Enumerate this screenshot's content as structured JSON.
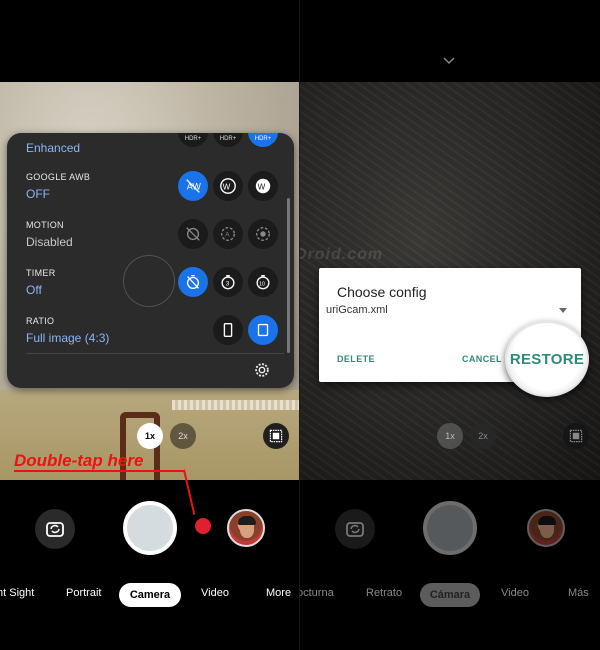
{
  "left_screen": {
    "settings": {
      "hdr_value": "Enhanced",
      "google_awb": {
        "label": "GOOGLE AWB",
        "value": "OFF"
      },
      "motion": {
        "label": "MOTION",
        "value": "Disabled"
      },
      "timer": {
        "label": "TIMER",
        "value": "Off"
      },
      "ratio": {
        "label": "RATIO",
        "value": "Full image (4:3)"
      },
      "hdr_icon_text": "HDR+",
      "timer_3": "3",
      "timer_10": "10"
    },
    "zoom": {
      "one": "1x",
      "two": "2x"
    },
    "annotation": "Double-tap here",
    "modes": {
      "night": "ht Sight",
      "portrait": "Portrait",
      "camera": "Camera",
      "video": "Video",
      "more": "More"
    }
  },
  "right_screen": {
    "watermark": "TheCustomDroid.com",
    "dialog": {
      "title": "Choose config",
      "selected": "uriGcam.xml",
      "delete": "DELETE",
      "cancel": "CANCEL",
      "restore": "RESTORE"
    },
    "zoom": {
      "one": "1x",
      "two": "2x"
    },
    "modes": {
      "night": "octurna",
      "portrait": "Retrato",
      "camera": "Cámara",
      "video": "Video",
      "more": "Más"
    }
  },
  "colors": {
    "accent_blue": "#1a73e8",
    "value_blue": "#8ab4f8",
    "annotation_red": "#e11111",
    "dialog_teal": "#2e8b7a"
  }
}
